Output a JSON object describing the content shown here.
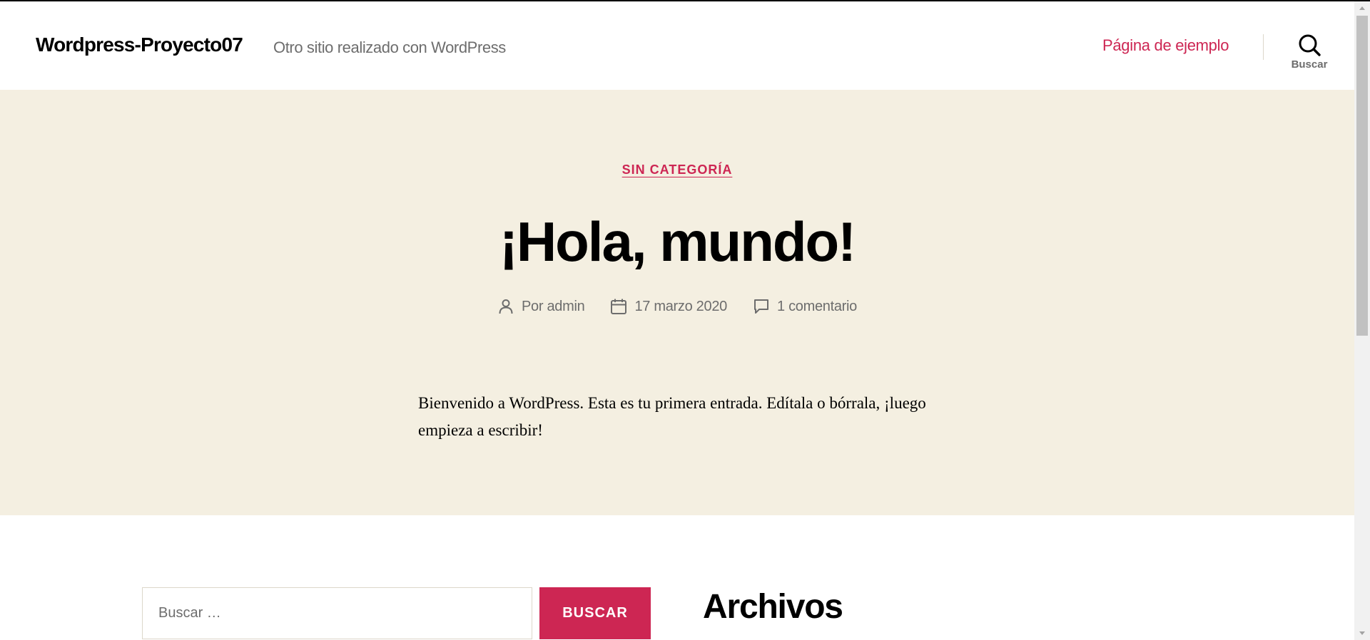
{
  "header": {
    "site_title": "Wordpress-Proyecto07",
    "site_description": "Otro sitio realizado con WordPress",
    "nav_link": "Página de ejemplo",
    "search_toggle_label": "Buscar",
    "search_icon": "search-icon"
  },
  "post": {
    "category": "SIN CATEGORÍA",
    "title": "¡Hola, mundo!",
    "meta": {
      "author_icon": "user-icon",
      "author": "Por admin",
      "date_icon": "calendar-icon",
      "date": "17 marzo 2020",
      "comments_icon": "comment-icon",
      "comments": "1 comentario"
    },
    "excerpt": "Bienvenido a WordPress. Esta es tu primera entrada. Edítala o bórrala, ¡luego empieza a escribir!"
  },
  "widgets": {
    "search": {
      "placeholder": "Buscar …",
      "value": "",
      "button_label": "BUSCAR"
    },
    "archives_title": "Archivos"
  },
  "colors": {
    "accent": "#cd2653",
    "hero_background": "#f4efe1",
    "muted_text": "#6d6d6d",
    "text": "#000000",
    "border": "#dcd7ca"
  }
}
